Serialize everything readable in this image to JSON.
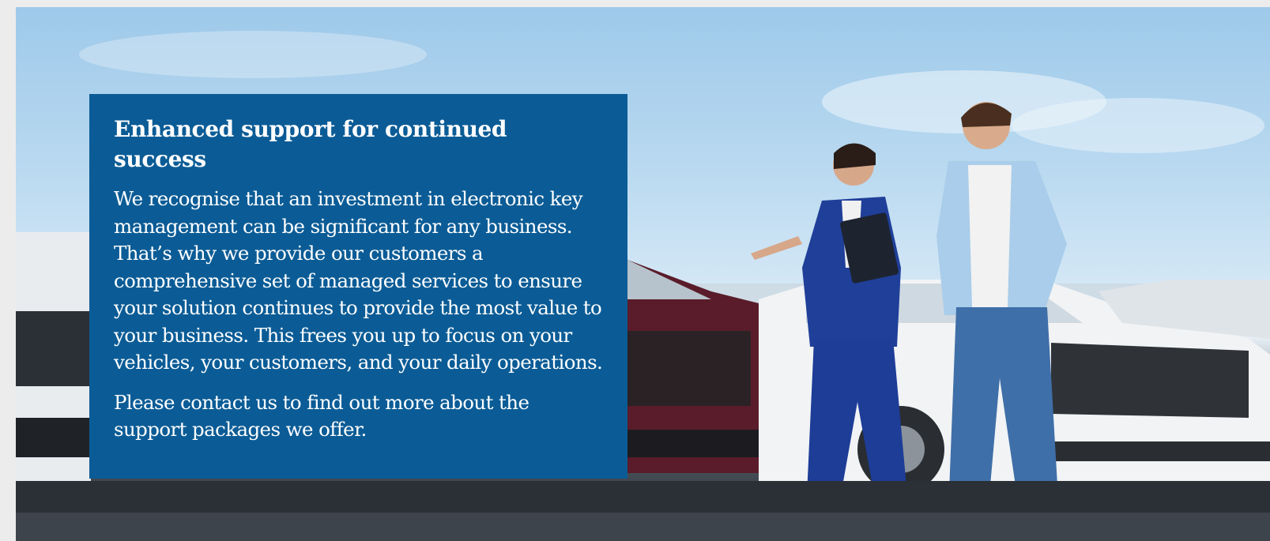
{
  "panel": {
    "heading": "Enhanced support for continued success",
    "paragraph_1": "We recognise that an investment in electronic key management can be significant for any business. That’s why we provide our customers a comprehensive set of managed services to ensure your solution continues to provide the most value to your business. This frees you up to focus on your vehicles, your customers, and your daily operations.",
    "paragraph_2": "Please contact us to find out more about the support packages we offer."
  },
  "colors": {
    "panel_background": "#0b5c96",
    "panel_text": "#ffffff",
    "page_background": "#ececec"
  }
}
